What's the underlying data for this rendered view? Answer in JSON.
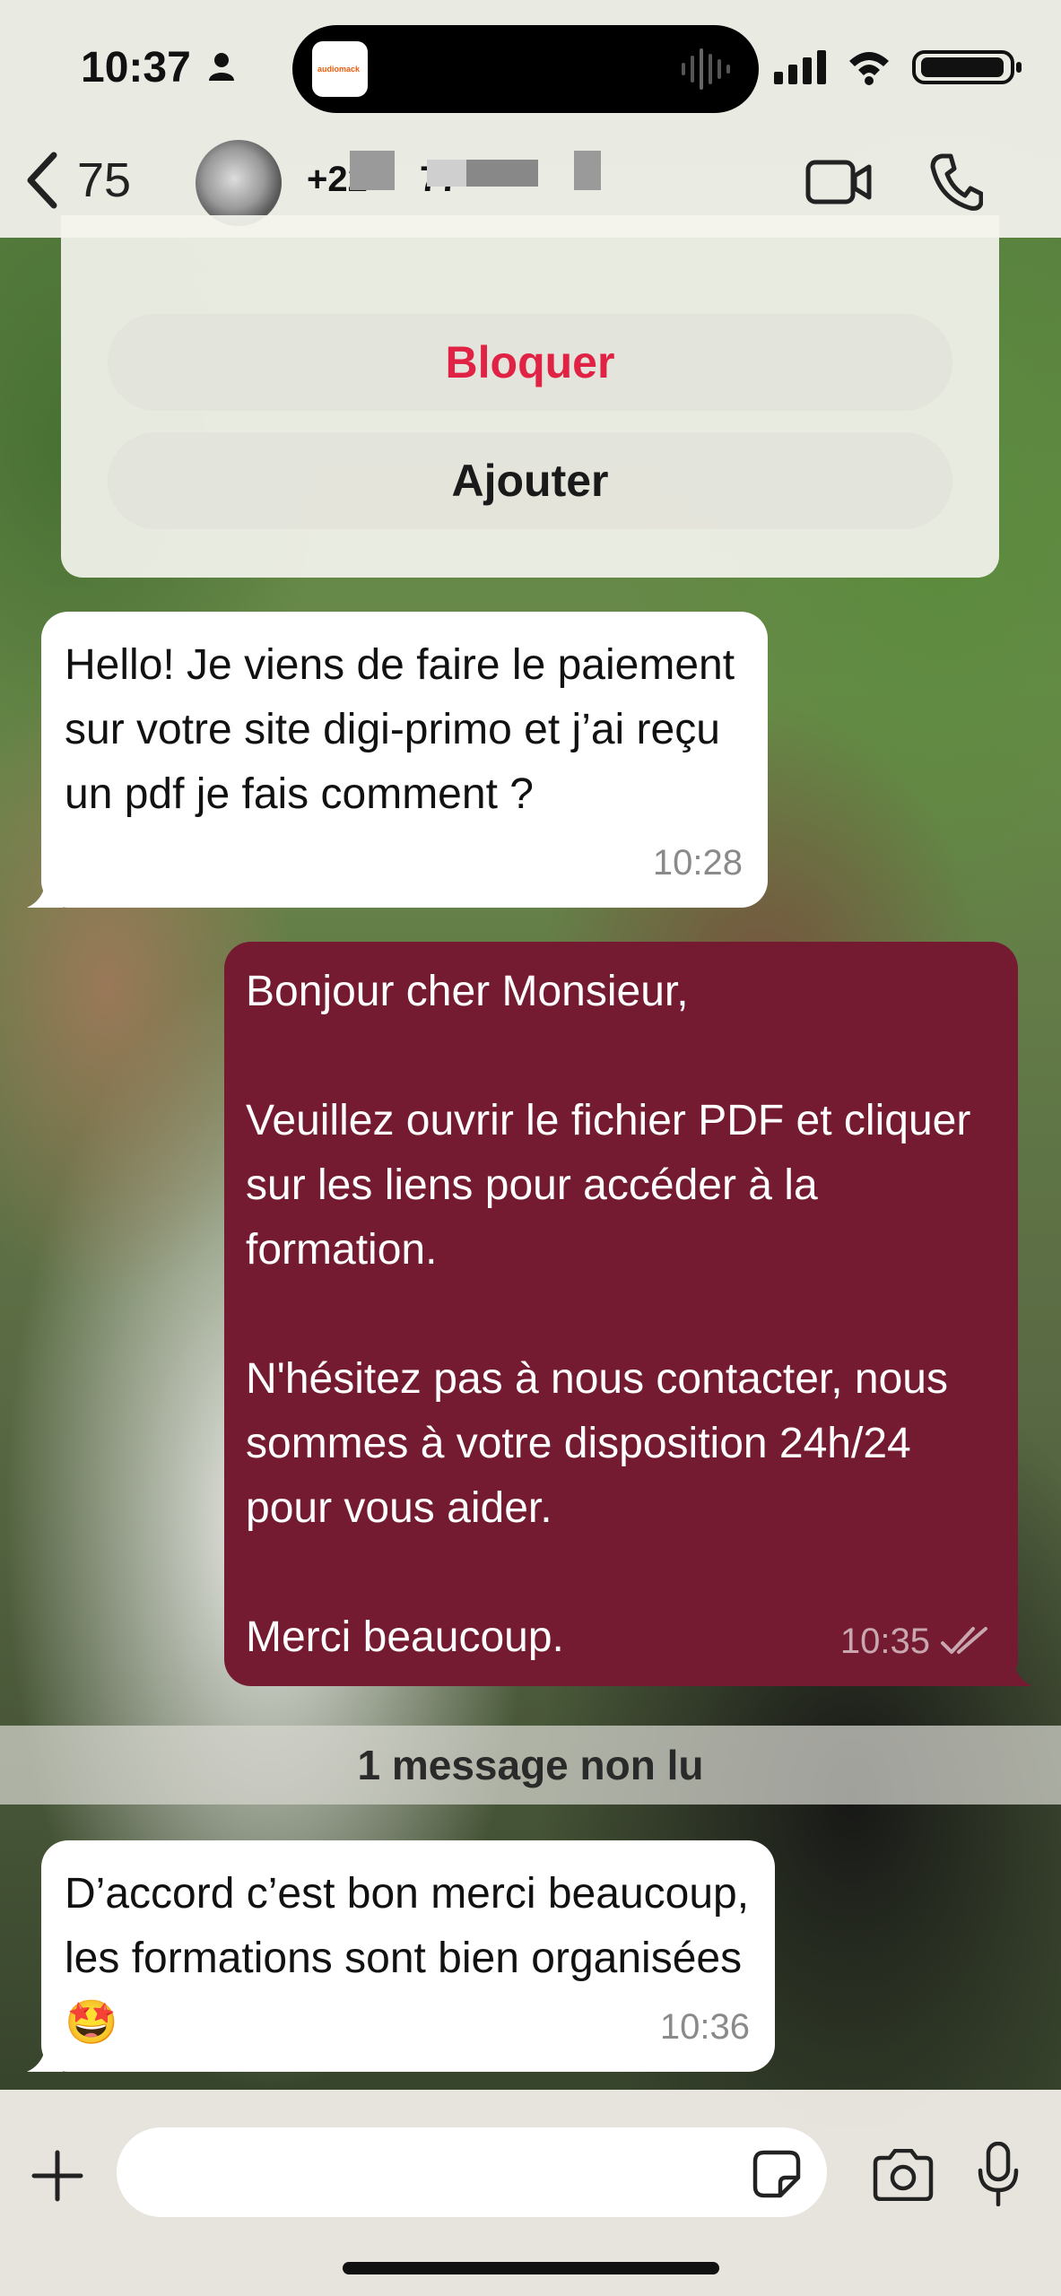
{
  "status_bar": {
    "time": "10:37",
    "dynamic_island_app": "audiomack"
  },
  "header": {
    "back_count": "75",
    "contact_name_visible": "+22",
    "contact_name_suffix": "77"
  },
  "actions": {
    "block_label": "Bloquer",
    "add_label": "Ajouter"
  },
  "messages": [
    {
      "direction": "incoming",
      "text": "Hello! Je viens de faire le paiement sur votre site digi-primo et j’ai reçu un pdf je fais comment ?",
      "time": "10:28"
    },
    {
      "direction": "outgoing",
      "text": "Bonjour cher Monsieur,\n\nVeuillez ouvrir le fichier PDF et cliquer sur les liens pour accéder à la formation.\n\nN'hésitez pas à nous contacter, nous sommes à votre disposition 24h/24 pour vous aider.\n\nMerci beaucoup.",
      "time": "10:35",
      "status": "read"
    },
    {
      "direction": "incoming",
      "text": "D’accord c’est bon merci beaucoup, les formations sont bien organisées 🤩",
      "time": "10:36"
    }
  ],
  "unread_banner": "1 message non lu",
  "composer": {
    "value": ""
  },
  "colors": {
    "outgoing_bubble": "#741b31",
    "incoming_bubble": "#ffffff",
    "block_text": "#e02245"
  }
}
